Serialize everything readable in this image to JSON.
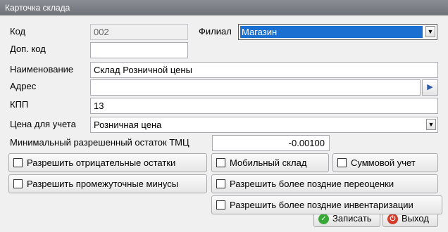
{
  "window": {
    "title": "Карточка склада"
  },
  "form": {
    "code_label": "Код",
    "code_value": "002",
    "branch_label": "Филиал",
    "branch_value": "Магазин",
    "extra_code_label": "Доп. код",
    "extra_code_value": "",
    "name_label": "Наименование",
    "name_value": "Склад Розничной цены",
    "address_label": "Адрес",
    "address_value": "",
    "kpp_label": "КПП",
    "kpp_value": "13",
    "price_label": "Цена для учета",
    "price_value": "Розничная цена",
    "min_stock_label": "Минимальный разрешенный остаток ТМЦ",
    "min_stock_value": "-0.00100"
  },
  "options": {
    "allow_negative": {
      "label": "Разрешить отрицательные остатки",
      "checked": false
    },
    "mobile_warehouse": {
      "label": "Мобильный склад",
      "checked": false
    },
    "sum_accounting": {
      "label": "Суммовой учет",
      "checked": false
    },
    "allow_intermediate_minus": {
      "label": "Разрешить промежуточные минусы",
      "checked": false
    },
    "allow_later_revaluation": {
      "label": "Разрешить более поздние переоценки",
      "checked": false
    },
    "allow_later_inventory": {
      "label": "Разрешить более поздние инвентаризации",
      "checked": false
    }
  },
  "actions": {
    "save_label": "Записать",
    "exit_label": "Выход"
  },
  "icons": {
    "dropdown": "chevron-down-icon",
    "address_action": "play-arrow-icon",
    "save": "check-icon",
    "exit": "power-icon"
  }
}
